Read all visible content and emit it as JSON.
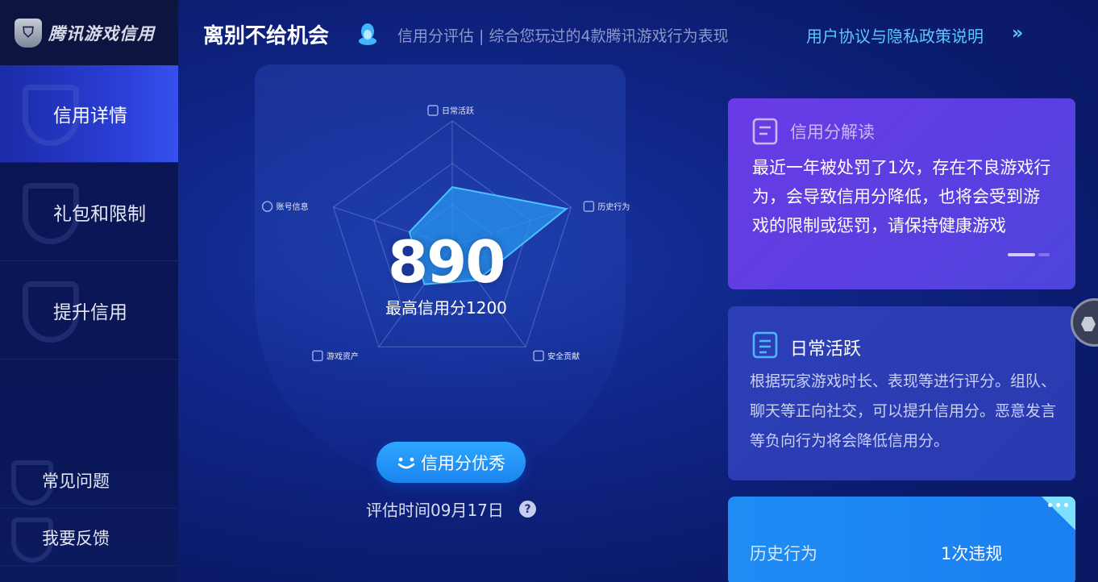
{
  "logo": {
    "text": "腾讯游戏信用"
  },
  "sidebar": {
    "items": [
      {
        "label": "信用详情",
        "active": true
      },
      {
        "label": "礼包和限制",
        "active": false
      },
      {
        "label": "提升信用",
        "active": false
      }
    ],
    "bottom": [
      {
        "label": "常见问题"
      },
      {
        "label": "我要反馈"
      }
    ]
  },
  "header": {
    "username": "离别不给机会",
    "account_icon": "qq-penguin-icon",
    "subtitle": "信用分评估 | 综合您玩过的4款腾讯游戏行为表现",
    "agreement_link": "用户协议与隐私政策说明",
    "agreement_arrow": "»"
  },
  "radar": {
    "axes": [
      {
        "label": "日常活跃",
        "icon": "list-icon"
      },
      {
        "label": "历史行为",
        "icon": "clock-icon"
      },
      {
        "label": "安全贡献",
        "icon": "shield-icon"
      },
      {
        "label": "游戏资产",
        "icon": "wallet-icon"
      },
      {
        "label": "账号信息",
        "icon": "user-icon"
      }
    ],
    "values": [
      0.47,
      0.96,
      0.34,
      0.38,
      0.36
    ]
  },
  "score": {
    "value": "890",
    "max_text": "最高信用分1200",
    "status": "信用分优秀",
    "eval_time": "评估时间09月17日",
    "help": "?"
  },
  "cards": {
    "interpret": {
      "title": "信用分解读",
      "body": "最近一年被处罚了1次，存在不良游戏行为，会导致信用分降低，也将会受到游戏的限制或惩罚，请保持健康游戏"
    },
    "daily": {
      "title": "日常活跃",
      "body": "根据玩家游戏时长、表现等进行评分。组队、聊天等正向社交，可以提升信用分。恶意发言等负向行为将会降低信用分。"
    },
    "history": {
      "label": "历史行为",
      "value": "1次违规",
      "more": "•••"
    }
  },
  "colors": {
    "accent": "#2ea7ff",
    "link": "#5cc6ff",
    "card_purple": "#6a3be6"
  }
}
